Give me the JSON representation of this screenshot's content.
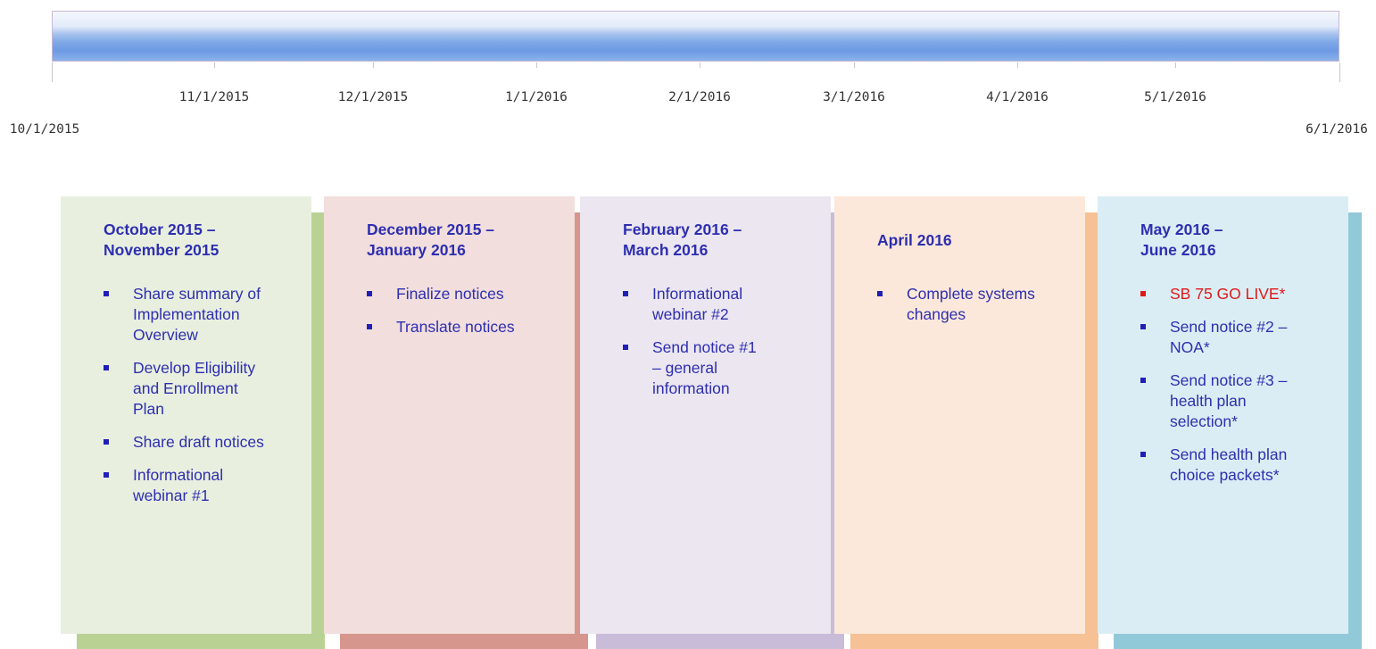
{
  "timeline": {
    "ticks": [
      {
        "label": "10/1/2015",
        "pos": 0,
        "row": "low"
      },
      {
        "label": "11/1/2015",
        "pos": 1,
        "row": "high"
      },
      {
        "label": "12/1/2015",
        "pos": 2,
        "row": "high"
      },
      {
        "label": "1/1/2016",
        "pos": 3,
        "row": "high"
      },
      {
        "label": "2/1/2016",
        "pos": 4,
        "row": "high"
      },
      {
        "label": "3/1/2016",
        "pos": 5,
        "row": "high"
      },
      {
        "label": "4/1/2016",
        "pos": 6,
        "row": "high"
      },
      {
        "label": "5/1/2016",
        "pos": 7,
        "row": "high"
      },
      {
        "label": "6/1/2016",
        "pos": 8,
        "row": "low"
      }
    ]
  },
  "phases": [
    {
      "title_line1": "October 2015 –",
      "title_line2": "November 2015",
      "card_color": "#e8efdf",
      "shadow_color": "#b9d293",
      "items": [
        {
          "text": "Share summary of Implementation Overview",
          "alert": false
        },
        {
          "text": "Develop Eligibility and Enrollment Plan",
          "alert": false
        },
        {
          "text": "Share draft notices",
          "alert": false
        },
        {
          "text": "Informational webinar #1",
          "alert": false
        }
      ]
    },
    {
      "title_line1": "December 2015 –",
      "title_line2": "January 2016",
      "card_color": "#f1dedd",
      "shadow_color": "#d6958d",
      "items": [
        {
          "text": "Finalize notices",
          "alert": false
        },
        {
          "text": "Translate notices",
          "alert": false
        }
      ]
    },
    {
      "title_line1": "February 2016 –",
      "title_line2": "March 2016",
      "card_color": "#ebe6f0",
      "shadow_color": "#c9bcd9",
      "items": [
        {
          "text": "Informational webinar #2",
          "alert": false
        },
        {
          "text": "Send notice #1 – general information",
          "alert": false
        }
      ]
    },
    {
      "title_line1": "April 2016",
      "title_line2": "",
      "card_color": "#fce8da",
      "shadow_color": "#f5c195",
      "items": [
        {
          "text": "Complete systems changes",
          "alert": false
        }
      ]
    },
    {
      "title_line1": "May 2016 –",
      "title_line2": "June 2016",
      "card_color": "#dbedf4",
      "shadow_color": "#92c9d9",
      "items": [
        {
          "text": "SB 75 GO LIVE*",
          "alert": true
        },
        {
          "text": "Send notice #2 – NOA*",
          "alert": false
        },
        {
          "text": "Send notice #3 – health plan selection*",
          "alert": false
        },
        {
          "text": "Send health plan choice packets*",
          "alert": false
        }
      ]
    }
  ]
}
